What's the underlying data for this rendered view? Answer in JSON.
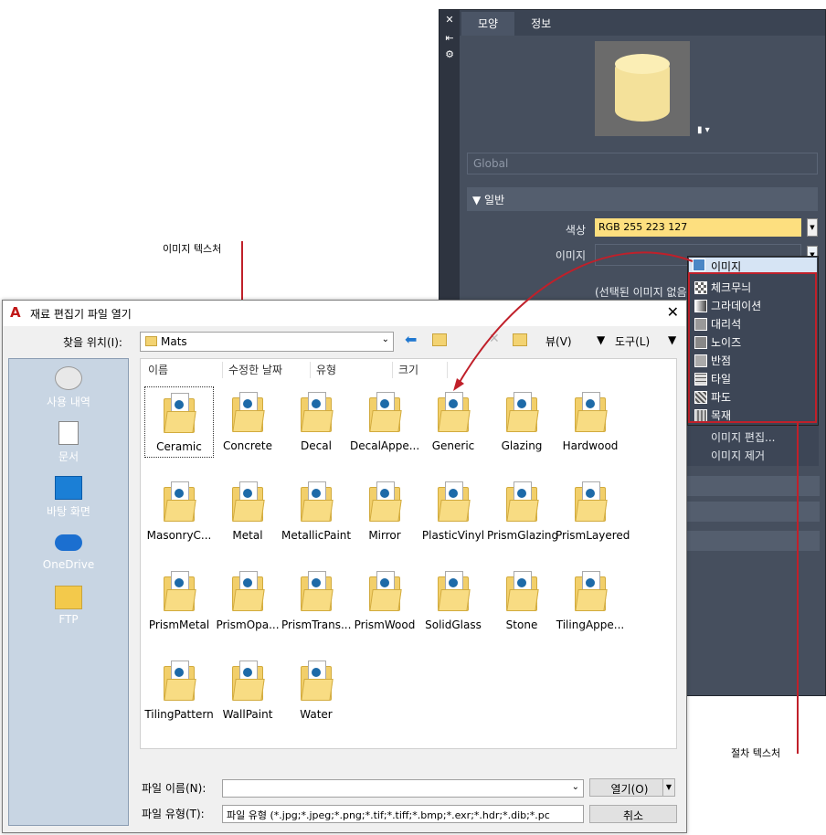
{
  "callouts": {
    "image_texture": "이미지 텍스처",
    "procedural_texture": "절차 텍스처"
  },
  "material_editor": {
    "strip": {
      "close": "✕",
      "pin": "⇤",
      "settings": "⚙"
    },
    "tabs": [
      {
        "label": "모양"
      },
      {
        "label": "정보"
      }
    ],
    "name_placeholder": "Global",
    "section_general": "▼ 일반",
    "color_label": "색상",
    "color_value": "RGB 255 223 127",
    "image_label": "이미지",
    "no_image": "(선택된 이미지 없음)",
    "popup": {
      "header": "이미지",
      "items": [
        "체크무늬",
        "그라데이션",
        "대리석",
        "노이즈",
        "반점",
        "타일",
        "파도",
        "목재"
      ],
      "extra": [
        "이미지 편집...",
        "이미지 제거"
      ]
    },
    "colors": {
      "panel": "#3b4453",
      "swatch": "#fddf7f",
      "highlight": "#c0202a"
    }
  },
  "dialog": {
    "title": "재료 편집기 파일 열기",
    "look_in_label": "찾을 위치(I):",
    "look_in_value": "Mats",
    "view_menu": "뷰(V)",
    "tools_menu": "도구(L)",
    "places": [
      "사용 내역",
      "문서",
      "바탕 화면",
      "OneDrive",
      "FTP"
    ],
    "columns": [
      "이름",
      "수정한 날짜",
      "유형",
      "크기"
    ],
    "files": [
      "Ceramic",
      "Concrete",
      "Decal",
      "DecalAppe...",
      "Generic",
      "Glazing",
      "Hardwood",
      "MasonryC...",
      "Metal",
      "MetallicPaint",
      "Mirror",
      "PlasticVinyl",
      "PrismGlazing",
      "PrismLayered",
      "PrismMetal",
      "PrismOpa...",
      "PrismTrans...",
      "PrismWood",
      "SolidGlass",
      "Stone",
      "TilingAppe...",
      "TilingPattern",
      "WallPaint",
      "Water"
    ],
    "filename_label": "파일 이름(N):",
    "filename_value": "",
    "filetype_label": "파일 유형(T):",
    "filetype_value": "파일 유형 (*.jpg;*.jpeg;*.png;*.tif;*.tiff;*.bmp;*.exr;*.hdr;*.dib;*.pc",
    "open_button": "열기(O)",
    "cancel_button": "취소"
  }
}
